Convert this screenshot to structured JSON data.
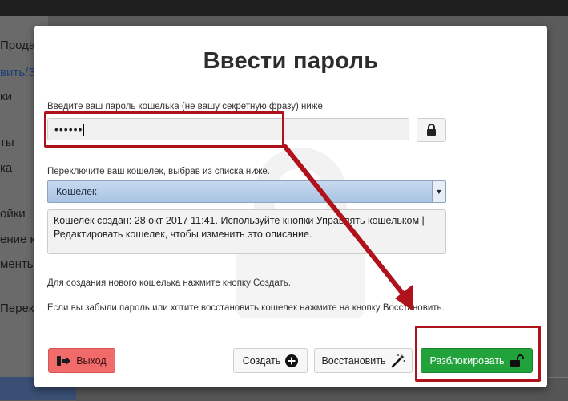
{
  "background": {
    "sidebar_items": [
      "Прода",
      "вить/За",
      "ки",
      "ты",
      "ка",
      "ойки",
      "ение к",
      "менты",
      "Перек"
    ]
  },
  "modal": {
    "title": "Ввести пароль",
    "password_label": "Введите ваш пароль кошелька (не вашу секретную фразу) ниже.",
    "password_value": "••••••",
    "wallet_label": "Переключите ваш кошелек, выбрав из списка ниже.",
    "wallet_selected": "Кошелек",
    "wallet_description": "Кошелек создан: 28 окт 2017 11:41. Используйте кнопки Управлять кошельком | Редактировать кошелек, чтобы изменить это описание.",
    "create_hint": "Для создания нового кошелька нажмите кнопку Создать.",
    "restore_hint": "Если вы забыли пароль или хотите восстановить кошелек нажмите на кнопку Восстановить.",
    "buttons": {
      "exit": "Выход",
      "create": "Создать",
      "restore": "Восстановить",
      "unlock": "Разблокировать"
    }
  },
  "colors": {
    "highlight": "#b0121b",
    "exit_button": "#f16b6b",
    "unlock_button": "#22a23a"
  },
  "icons": [
    "lock-icon",
    "dropdown-arrow-icon",
    "exit-icon",
    "plus-circle-icon",
    "magic-wand-icon",
    "unlock-icon",
    "padlock-watermark-icon",
    "arrow-annotation"
  ]
}
